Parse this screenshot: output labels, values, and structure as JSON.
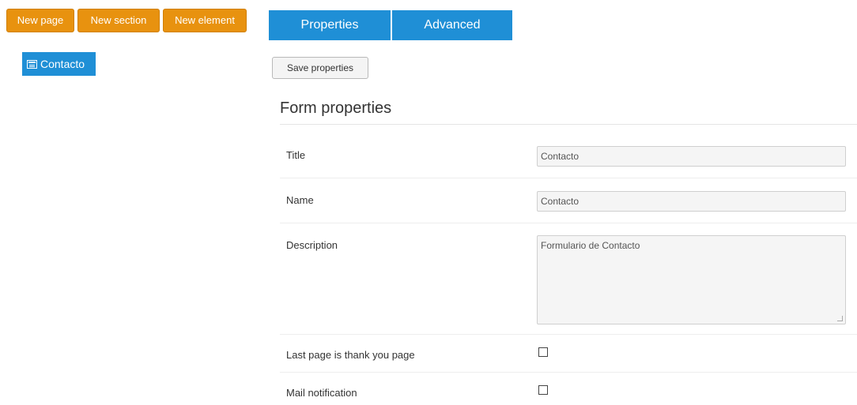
{
  "toolbar": {
    "new_page": "New page",
    "new_section": "New section",
    "new_element": "New element"
  },
  "tree": {
    "item_label": "Contacto",
    "item_icon": "form-icon"
  },
  "tabs": [
    {
      "label": "Properties",
      "active": true
    },
    {
      "label": "Advanced",
      "active": false
    }
  ],
  "save_button": "Save properties",
  "section_title": "Form properties",
  "fields": {
    "title": {
      "label": "Title",
      "value": "Contacto"
    },
    "name": {
      "label": "Name",
      "value": "Contacto"
    },
    "description": {
      "label": "Description",
      "value": "Formulario de Contacto"
    },
    "thank_you": {
      "label": "Last page is thank you page",
      "checked": false
    },
    "mail_notification": {
      "label": "Mail notification",
      "checked": false
    }
  },
  "colors": {
    "toolbar_orange": "#e8920f",
    "accent_blue": "#1f8fd6"
  }
}
